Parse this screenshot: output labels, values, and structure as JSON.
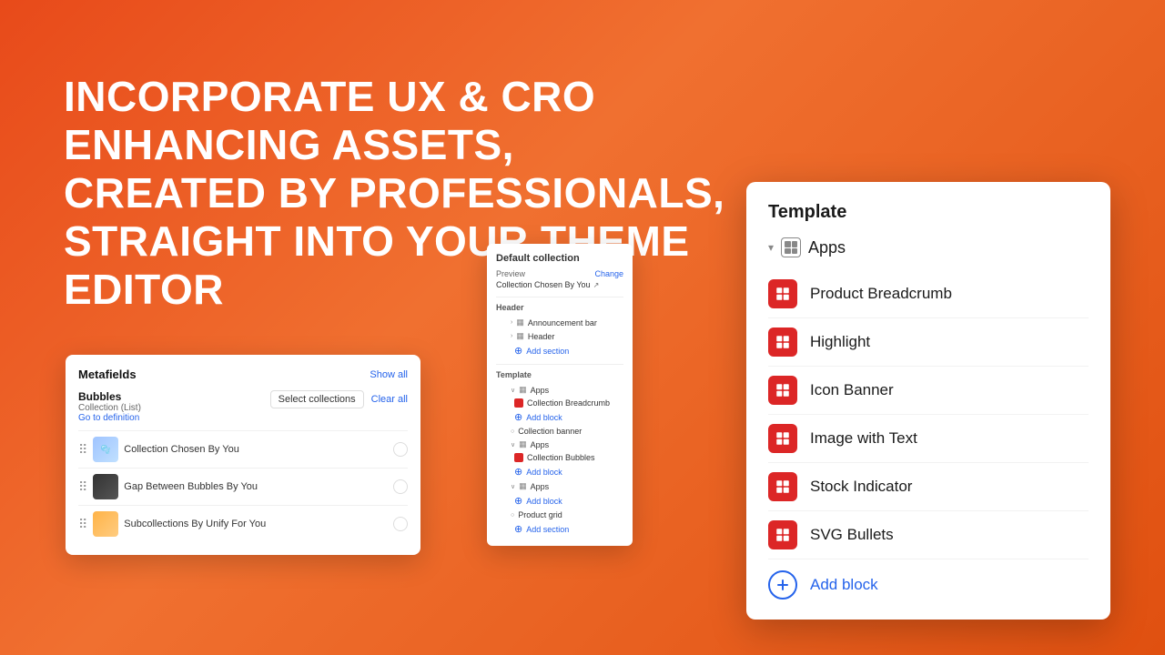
{
  "headline": {
    "line1": "INCORPORATE UX & CRO ENHANCING ASSETS,",
    "line2": "CREATED BY PROFESSIONALS,",
    "line3": "STRAIGHT INTO YOUR THEME EDITOR"
  },
  "metafields_card": {
    "title": "Metafields",
    "show_all": "Show all",
    "field_name": "Bubbles",
    "field_type": "Collection (List)",
    "go_definition": "Go to definition",
    "select_btn": "Select collections",
    "clear_btn": "Clear all",
    "items": [
      {
        "name": "Collection Chosen By You",
        "thumb": "bubble"
      },
      {
        "name": "Gap Between Bubbles By You",
        "thumb": "gap"
      },
      {
        "name": "Subcollections By Unify For You",
        "thumb": "sub"
      }
    ]
  },
  "theme_panel": {
    "section_title": "Default collection",
    "preview_label": "Preview",
    "change_label": "Change",
    "preview_value": "Collection Chosen By You",
    "header_label": "Header",
    "items": [
      {
        "label": "Announcement bar",
        "indent": 1
      },
      {
        "label": "Header",
        "indent": 1
      }
    ],
    "add_section": "Add section",
    "template_label": "Template",
    "template_items": [
      {
        "label": "Apps",
        "type": "apps"
      },
      {
        "label": "Collection Breadcrumb",
        "type": "block",
        "indent": 2
      },
      {
        "label": "Add block",
        "type": "add",
        "indent": 2
      },
      {
        "label": "Collection banner",
        "type": "normal",
        "indent": 1
      },
      {
        "label": "Apps",
        "type": "apps"
      },
      {
        "label": "Collection Bubbles",
        "type": "block",
        "indent": 2
      },
      {
        "label": "Add block",
        "type": "add",
        "indent": 2
      },
      {
        "label": "Apps",
        "type": "apps"
      },
      {
        "label": "Add block",
        "type": "add",
        "indent": 2
      },
      {
        "label": "Product grid",
        "type": "normal",
        "indent": 1
      }
    ],
    "add_section2": "Add section"
  },
  "template_card": {
    "heading": "Template",
    "apps_label": "Apps",
    "items": [
      {
        "label": "Product Breadcrumb"
      },
      {
        "label": "Highlight"
      },
      {
        "label": "Icon Banner"
      },
      {
        "label": "Image with Text"
      },
      {
        "label": "Stock Indicator"
      },
      {
        "label": "SVG Bullets"
      }
    ],
    "add_block_label": "Add block"
  }
}
